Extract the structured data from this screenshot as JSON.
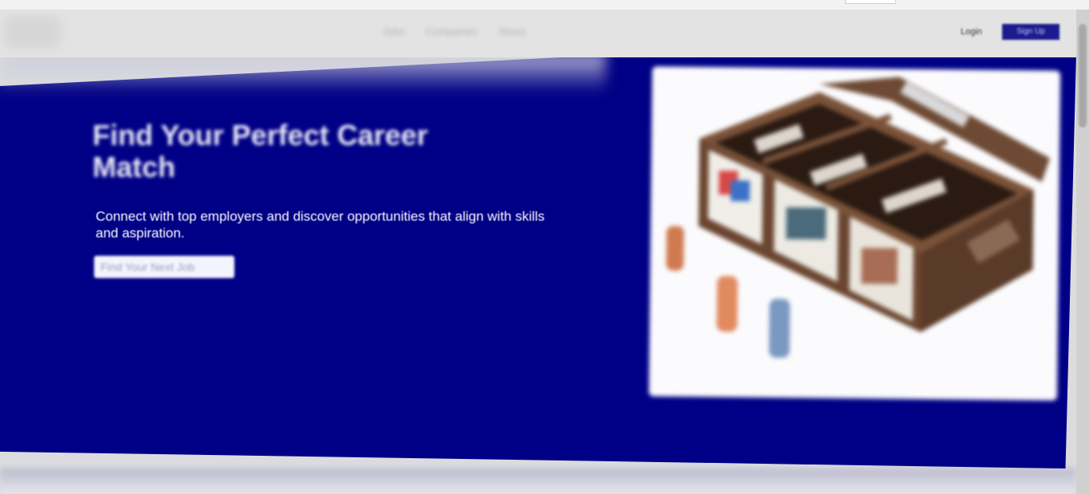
{
  "nav": {
    "links": [
      "Jobs",
      "Companies",
      "About"
    ],
    "login_label": "Login",
    "signup_label": "Sign Up"
  },
  "hero": {
    "title": "Find Your Perfect Career Match",
    "subtitle": "Connect with top employers and discover opportunities that align with skills and aspiration.",
    "cta_label": "Find Your Next Job",
    "image_alt": "wooden box with cards and figurines"
  },
  "colors": {
    "hero_background": "#000086",
    "cta_background": "#f4f4ff",
    "signup_background": "#1b1b8f"
  }
}
